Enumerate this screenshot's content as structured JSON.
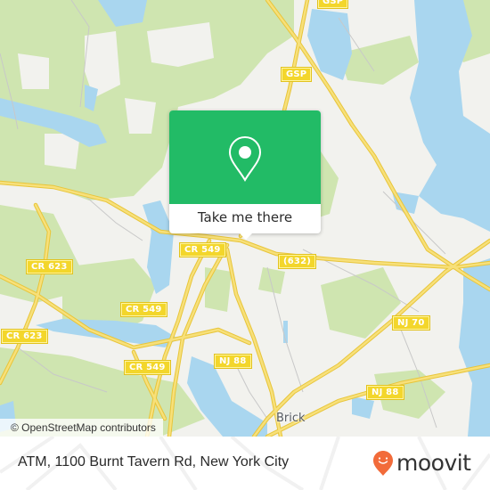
{
  "map": {
    "colors": {
      "land": "#f2f2ee",
      "forest": "#cfe5b0",
      "water": "#a9d6ef",
      "road": "#f5d84e",
      "road_casing": "#e8c53a",
      "minor_road": "#c8c8c8"
    },
    "road_shields": [
      {
        "label": "GSP",
        "id": "gsp-top"
      },
      {
        "label": "GSP",
        "id": "gsp"
      },
      {
        "label": "CR 623",
        "id": "cr623-upper"
      },
      {
        "label": "CR 623",
        "id": "cr623-lower"
      },
      {
        "label": "CR 549",
        "id": "cr549-center"
      },
      {
        "label": "CR 549",
        "id": "cr549-mid"
      },
      {
        "label": "CR 549",
        "id": "cr549-lower"
      },
      {
        "label": "(632)",
        "id": "cr632"
      },
      {
        "label": "NJ 70",
        "id": "nj70"
      },
      {
        "label": "NJ 88",
        "id": "nj88-west"
      },
      {
        "label": "NJ 88",
        "id": "nj88-east"
      }
    ],
    "place_labels": [
      {
        "label": "Brick"
      }
    ],
    "attribution": "© OpenStreetMap contributors"
  },
  "popup": {
    "icon": "map-pin-icon",
    "button_label": "Take me there",
    "accent_color": "#22bb66"
  },
  "footer": {
    "address": "ATM, 1100 Burnt Tavern Rd, New York City",
    "brand": "moovit",
    "brand_color": "#f26b3a"
  }
}
